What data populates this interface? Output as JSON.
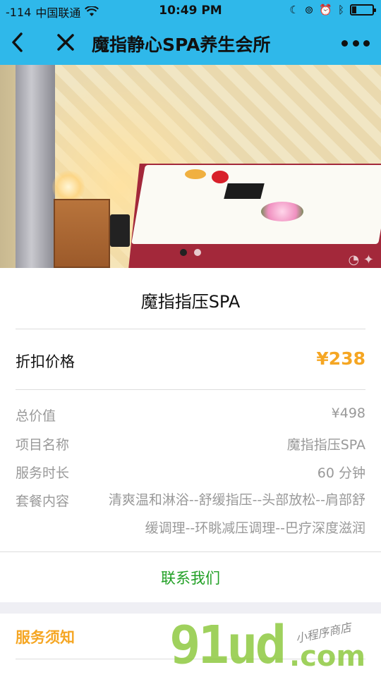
{
  "status_bar": {
    "signal_text": "-114",
    "carrier": "中国联通",
    "time": "10:49 PM",
    "battery_level_pct": 20
  },
  "nav": {
    "title": "魔指静心SPA养生会所",
    "icons": [
      "back-chevron-icon",
      "close-icon",
      "more-icon"
    ]
  },
  "hero": {
    "slides_count": 2,
    "active_slide": 1
  },
  "product": {
    "name": "魔指指压SPA",
    "price_label": "折扣价格",
    "price_value": "¥238",
    "details": [
      {
        "label": "总价值",
        "value": "¥498"
      },
      {
        "label": "项目名称",
        "value": "魔指指压SPA"
      },
      {
        "label": "服务时长",
        "value": "60 分钟"
      },
      {
        "label": "套餐内容",
        "value": "清爽温和淋浴--舒缓指压--头部放松--肩部舒缓调理--环眺减压调理--巴疗深度滋润"
      }
    ],
    "contact_label": "联系我们"
  },
  "notice": {
    "title": "服务须知"
  },
  "watermark": {
    "brand": "91ud",
    "suffix": ".com",
    "tagline": "小程序商店"
  },
  "colors": {
    "nav_bg": "#2fb8ea",
    "price": "#f5a623",
    "contact": "#21a025",
    "notice_title": "#f5a623"
  }
}
